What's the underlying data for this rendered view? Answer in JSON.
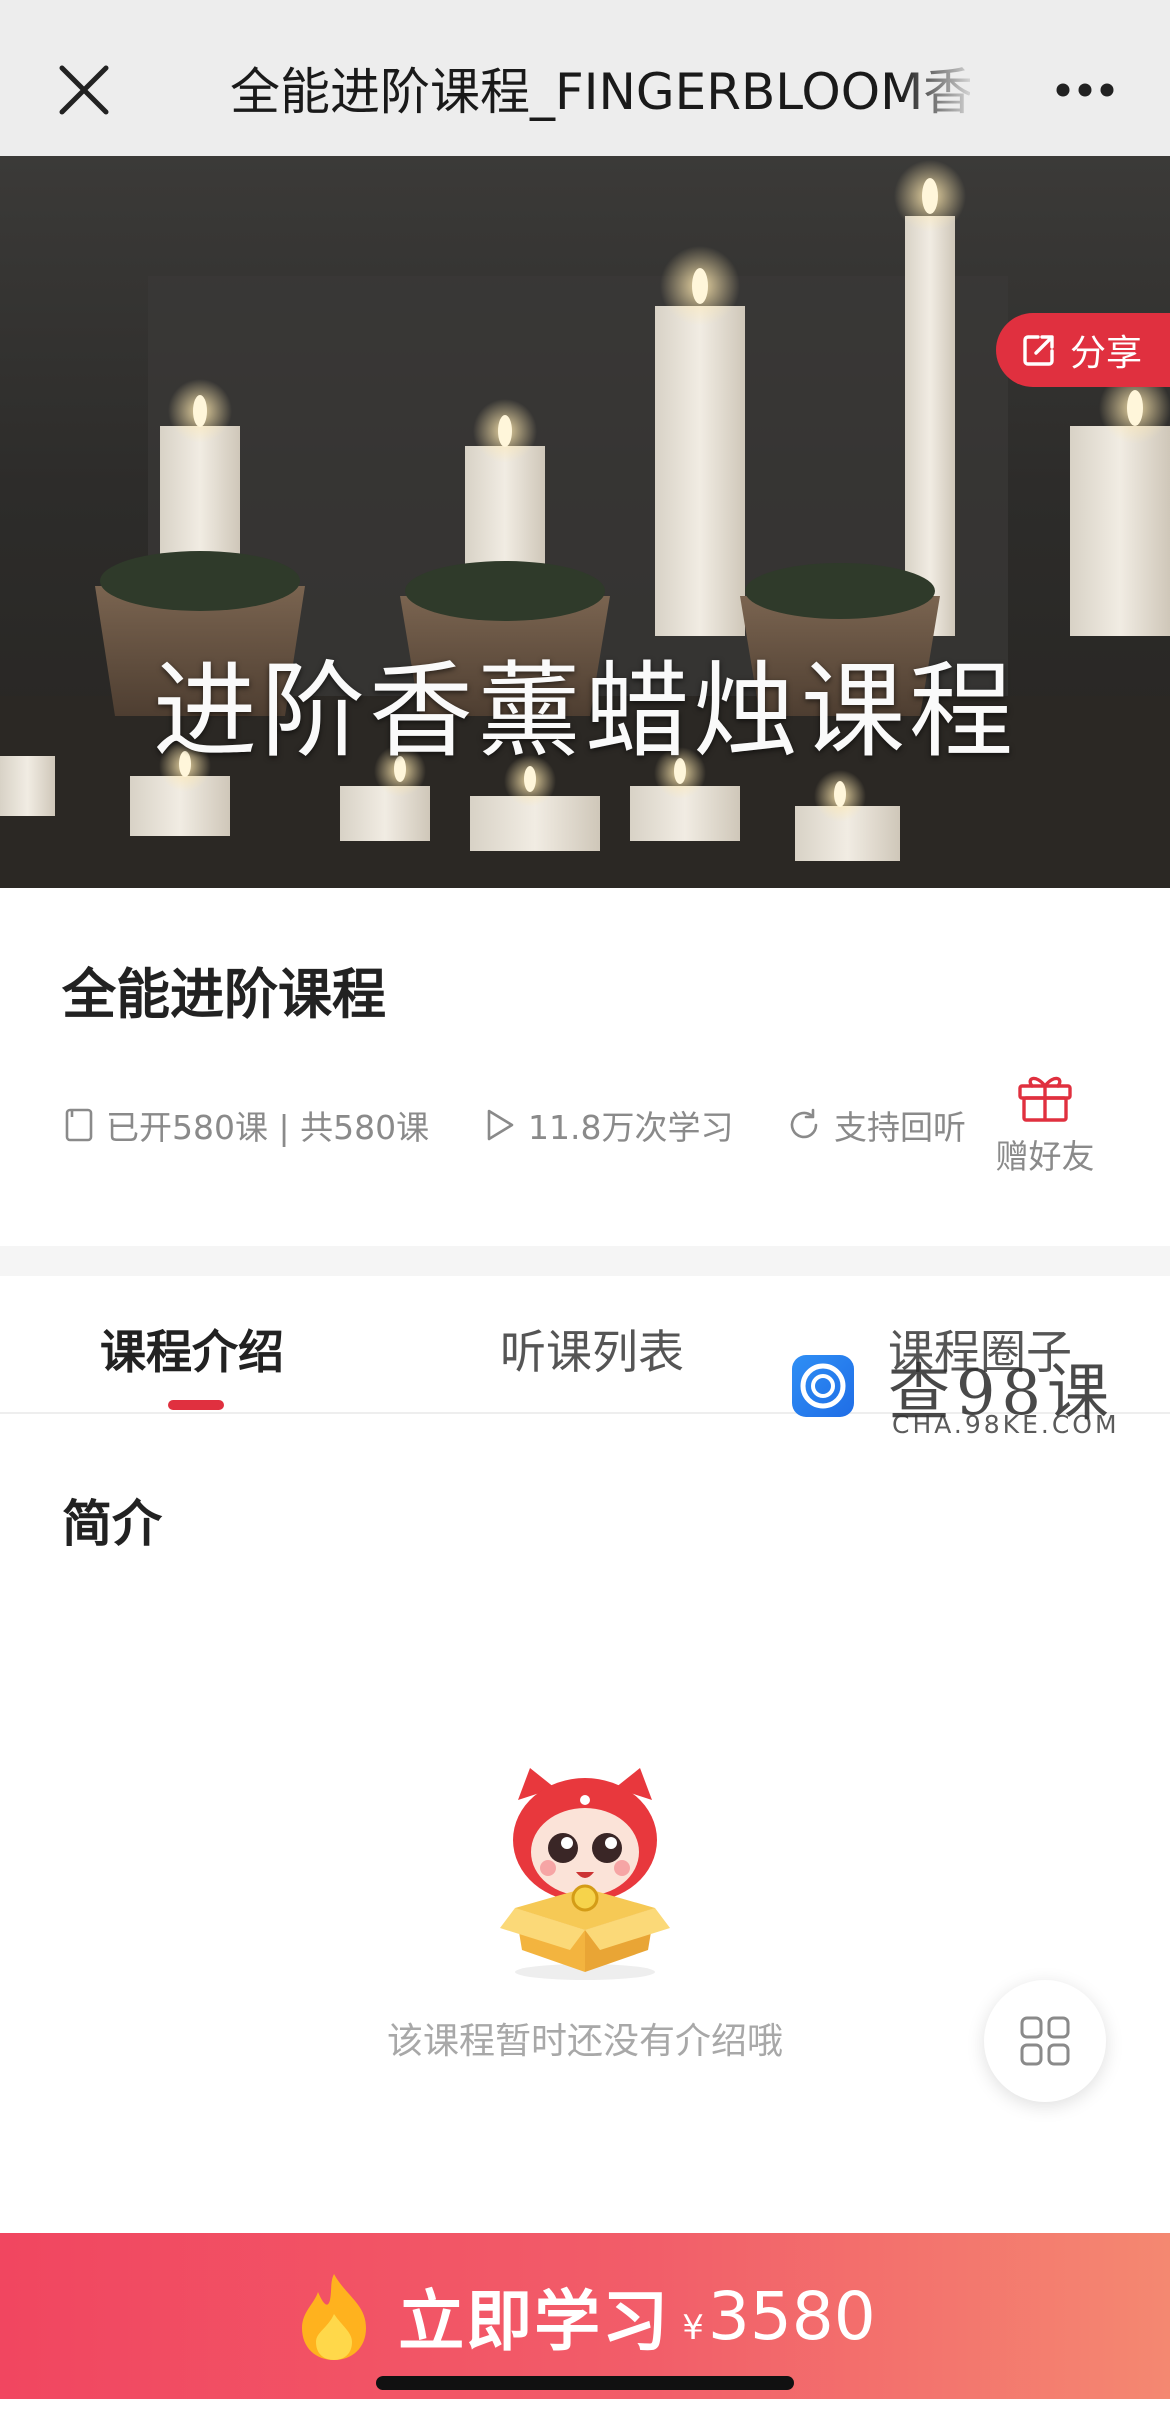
{
  "nav": {
    "title": "全能进阶课程_FINGERBLOOM香",
    "close_icon": "close-icon",
    "more_icon": "more-dots-icon"
  },
  "hero": {
    "banner_text": "进阶香薰蜡烛课程",
    "share_label": "分享",
    "share_color": "#e0303f"
  },
  "course": {
    "title": "全能进阶课程",
    "lessons": "已开580课 | 共580课",
    "plays": "11.8万次学习",
    "replay": "支持回听",
    "gift_label": "赠好友"
  },
  "tabs": [
    {
      "label": "课程介绍",
      "active": true
    },
    {
      "label": "听课列表",
      "active": false
    },
    {
      "label": "课程圈子",
      "active": false
    }
  ],
  "watermark": {
    "text": "查98课",
    "url": "CHA.98KE.COM"
  },
  "intro": {
    "section_title": "简介",
    "empty_text": "该课程暂时还没有介绍哦"
  },
  "cta": {
    "label": "立即学习",
    "currency": "¥",
    "price": "3580",
    "accent_color": "#f14660"
  }
}
